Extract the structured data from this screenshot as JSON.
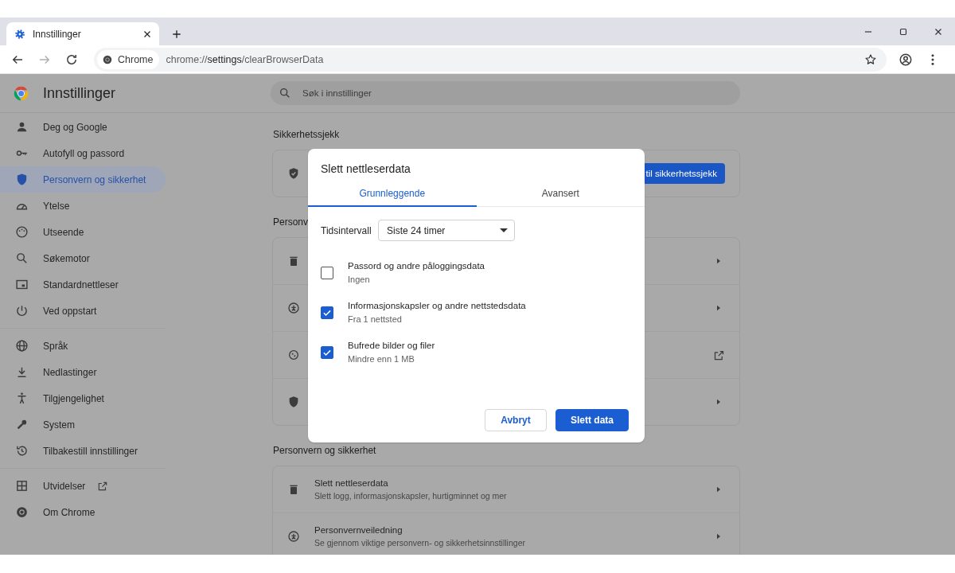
{
  "browser": {
    "tabs": [
      {
        "label": "Innstillinger",
        "selected": true
      }
    ],
    "address": {
      "chip": "Chrome",
      "url": "chrome://**settings**/clearBrowserData"
    }
  },
  "settings": {
    "title": "Innstillinger",
    "search": {
      "placeholder": "Søk i innstillinger"
    },
    "sidebar": {
      "groups": [
        {
          "items": [
            {
              "label": "Deg og Google",
              "selected": false,
              "kind": "page"
            },
            {
              "label": "Autofyll og passord",
              "selected": false,
              "kind": "page"
            },
            {
              "label": "Personvern og sikkerhet",
              "selected": true,
              "kind": "page"
            },
            {
              "label": "Ytelse",
              "selected": false,
              "kind": "page"
            },
            {
              "label": "Utseende",
              "selected": false,
              "kind": "page"
            },
            {
              "label": "Søkemotor",
              "selected": false,
              "kind": "page"
            },
            {
              "label": "Standardnettleser",
              "selected": false,
              "kind": "page"
            },
            {
              "label": "Ved oppstart",
              "selected": false,
              "kind": "page"
            }
          ]
        },
        {
          "items": [
            {
              "label": "Språk",
              "selected": false,
              "kind": "page"
            },
            {
              "label": "Nedlastinger",
              "selected": false,
              "kind": "page"
            },
            {
              "label": "Tilgjengelighet",
              "selected": false,
              "kind": "page"
            },
            {
              "label": "System",
              "selected": false,
              "kind": "page"
            },
            {
              "label": "Tilbakestill innstillinger",
              "selected": false,
              "kind": "page"
            }
          ]
        },
        {
          "items": [
            {
              "label": "Utvidelser",
              "selected": false,
              "kind": "external"
            },
            {
              "label": "Om Chrome",
              "selected": false,
              "kind": "page"
            }
          ]
        }
      ]
    },
    "sections": [
      {
        "heading": "Sikkerhetssjekk",
        "kind": "safety",
        "button": "til sikkerhetssjekk"
      },
      {
        "heading": "Personv",
        "kind": "rows",
        "rows": [
          {
            "kind": "arrow"
          },
          {
            "kind": "arrow"
          },
          {
            "kind": "external"
          },
          {
            "kind": "arrow"
          }
        ]
      },
      {
        "heading": "Personvern og sikkerhet",
        "kind": "rows",
        "rows": [
          {
            "title": "Slett nettleserdata",
            "subtitle": "Slett logg, informasjonskapsler, hurtigminnet og mer",
            "kind": "arrow"
          },
          {
            "title": "Personvernveiledning",
            "subtitle": "Se gjennom viktige personvern- og sikkerhetsinnstillinger",
            "kind": "arrow"
          }
        ]
      }
    ]
  },
  "dialog": {
    "title": "Slett nettleserdata",
    "tabs": [
      {
        "label": "Grunnleggende",
        "selected": true
      },
      {
        "label": "Avansert",
        "selected": false
      }
    ],
    "time_range": {
      "label": "Tidsintervall",
      "value": "Siste 24 timer"
    },
    "options": [
      {
        "title": "Passord og andre påloggingsdata",
        "detail": "Ingen",
        "checked": false
      },
      {
        "title": "Informasjonskapsler og andre nettstedsdata",
        "detail": "Fra 1 nettsted",
        "checked": true
      },
      {
        "title": "Bufrede bilder og filer",
        "detail": "Mindre enn 1 MB",
        "checked": true
      }
    ],
    "buttons": [
      {
        "label": "Avbryt",
        "kind": "secondary"
      },
      {
        "label": "Slett data",
        "kind": "primary"
      }
    ]
  }
}
